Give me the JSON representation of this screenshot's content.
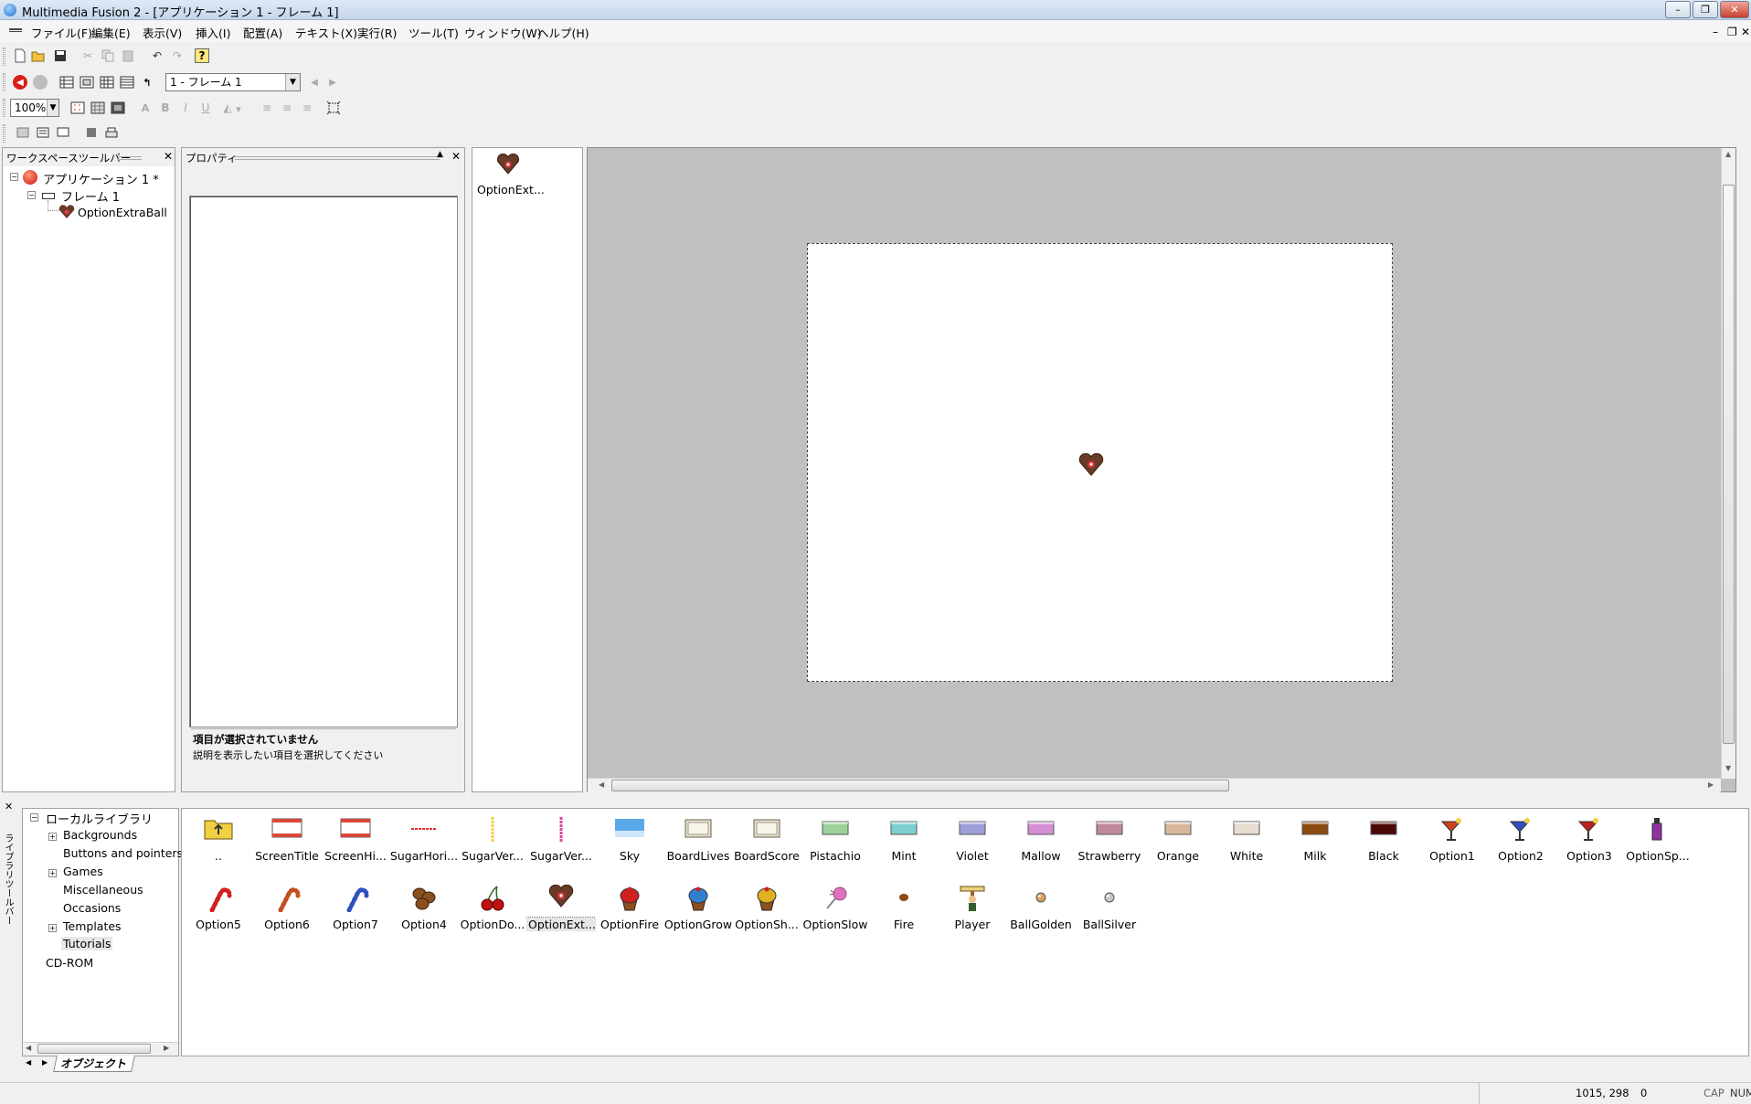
{
  "window": {
    "title": "Multimedia Fusion 2 - [アプリケーション 1 - フレーム 1]",
    "controls": [
      "–",
      "❐",
      "✕"
    ],
    "mdi_controls": [
      "–",
      "❐",
      "✕"
    ]
  },
  "menu": {
    "items": [
      "ファイル(F)",
      "編集(E)",
      "表示(V)",
      "挿入(I)",
      "配置(A)",
      "テキスト(X)",
      "実行(R)",
      "ツール(T)",
      "ウィンドウ(W)",
      "ヘルプ(H)"
    ]
  },
  "toolbar": {
    "frame_select": "1 - フレーム 1",
    "zoom": "100%",
    "font_bold": "B",
    "font_italic": "I",
    "font_underline": "U"
  },
  "workspace": {
    "title": "ワークスペースツールバー",
    "tree": [
      {
        "label": "アプリケーション 1 *",
        "level": 0,
        "icon": "application-icon"
      },
      {
        "label": "フレーム 1",
        "level": 1,
        "icon": "frame-icon"
      },
      {
        "label": "OptionExtraBall",
        "level": 2,
        "icon": "heart-donut-icon"
      }
    ]
  },
  "properties": {
    "title": "プロパティ",
    "info_title": "項目が選択されていません",
    "info_text": "説明を表示したい項目を選択してください"
  },
  "frame_objects": {
    "items": [
      {
        "label": "OptionExt...",
        "icon": "heart-donut-icon"
      }
    ]
  },
  "library_tree": {
    "side_label": "ライブラリツールバー",
    "root": "ローカルライブラリ",
    "items": [
      {
        "label": "Backgrounds",
        "expandable": true
      },
      {
        "label": "Buttons and pointers",
        "expandable": false
      },
      {
        "label": "Games",
        "expandable": true
      },
      {
        "label": "Miscellaneous",
        "expandable": false
      },
      {
        "label": "Occasions",
        "expandable": false
      },
      {
        "label": "Templates",
        "expandable": true
      },
      {
        "label": "Tutorials",
        "expandable": false,
        "selected": true
      }
    ],
    "cdrom": "CD-ROM",
    "tab": "オブジェクト"
  },
  "library_items": [
    {
      "label": "..",
      "icon": "folder-up-icon"
    },
    {
      "label": "ScreenTitle",
      "icon": "screen-icon",
      "color": "#d84a3a"
    },
    {
      "label": "ScreenHi...",
      "icon": "screen-icon",
      "color": "#d84a3a"
    },
    {
      "label": "SugarHori...",
      "icon": "hline-icon",
      "color": "#e03030"
    },
    {
      "label": "SugarVer...",
      "icon": "vline-icon",
      "color": "#f0d040"
    },
    {
      "label": "SugarVer...",
      "icon": "vline-icon",
      "color": "#e040a0"
    },
    {
      "label": "Sky",
      "icon": "tile-icon",
      "color": "#5aa8e8"
    },
    {
      "label": "BoardLives",
      "icon": "board-icon",
      "color": "#e8e2d0"
    },
    {
      "label": "BoardScore",
      "icon": "board-icon",
      "color": "#e8e2d0"
    },
    {
      "label": "Pistachio",
      "icon": "bar-icon",
      "color": "#9ad29a"
    },
    {
      "label": "Mint",
      "icon": "bar-icon",
      "color": "#7ccfcf"
    },
    {
      "label": "Violet",
      "icon": "bar-icon",
      "color": "#9da0d8"
    },
    {
      "label": "Mallow",
      "icon": "bar-icon",
      "color": "#d48ed4"
    },
    {
      "label": "Strawberry",
      "icon": "bar-icon",
      "color": "#c08a9a"
    },
    {
      "label": "Orange",
      "icon": "bar-icon",
      "color": "#d8b89a"
    },
    {
      "label": "White",
      "icon": "bar-icon",
      "color": "#e6ddd0"
    },
    {
      "label": "Milk",
      "icon": "bar-icon",
      "color": "#8a4a10"
    },
    {
      "label": "Black",
      "icon": "bar-icon",
      "color": "#4a0808"
    },
    {
      "label": "Option1",
      "icon": "cocktail-icon",
      "color": "#d04020"
    },
    {
      "label": "Option2",
      "icon": "cocktail-icon",
      "color": "#3050c0"
    },
    {
      "label": "Option3",
      "icon": "cocktail-icon",
      "color": "#c02020"
    },
    {
      "label": "OptionSp...",
      "icon": "bottle-icon",
      "color": "#9030a0"
    },
    {
      "label": "Option5",
      "icon": "candy-cane-icon",
      "color": "#d02020"
    },
    {
      "label": "Option6",
      "icon": "candy-cane-icon",
      "color": "#c05020"
    },
    {
      "label": "Option7",
      "icon": "candy-cane-icon",
      "color": "#3050c0"
    },
    {
      "label": "Option4",
      "icon": "nuts-icon",
      "color": "#8a5020"
    },
    {
      "label": "OptionDo...",
      "icon": "cherry-icon",
      "color": "#c01010"
    },
    {
      "label": "OptionExt...",
      "icon": "heart-donut-icon",
      "color": "#6a3a2a",
      "selected": true
    },
    {
      "label": "OptionFire",
      "icon": "cupcake-icon",
      "color": "#d02020"
    },
    {
      "label": "OptionGrow",
      "icon": "cupcake-icon",
      "color": "#3080d0"
    },
    {
      "label": "OptionSh...",
      "icon": "cupcake-icon",
      "color": "#e0b020"
    },
    {
      "label": "OptionSlow",
      "icon": "lollipop-icon",
      "color": "#e070c0"
    },
    {
      "label": "Fire",
      "icon": "dot-icon",
      "color": "#8a4a10"
    },
    {
      "label": "Player",
      "icon": "player-icon",
      "color": "#a06020"
    },
    {
      "label": "BallGolden",
      "icon": "ball-icon",
      "color": "#d8a060"
    },
    {
      "label": "BallSilver",
      "icon": "ball-icon",
      "color": "#c8c8c8"
    }
  ],
  "statusbar": {
    "coords": "1015, 298",
    "value": "0",
    "cap": "CAP",
    "num": "NUM"
  }
}
